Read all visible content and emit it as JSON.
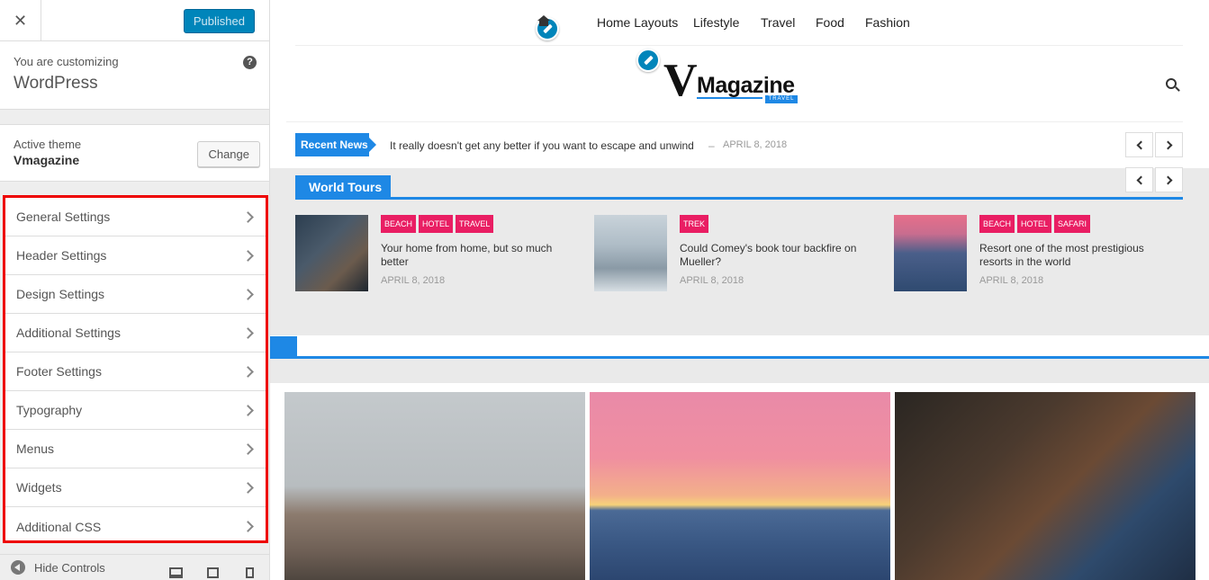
{
  "sidebar": {
    "close_symbol": "✕",
    "publish_label": "Published",
    "customizing_label": "You are customizing",
    "site_name": "WordPress",
    "help_symbol": "?",
    "active_theme_label": "Active theme",
    "theme_name": "Vmagazine",
    "change_label": "Change",
    "panels": [
      "General Settings",
      "Header Settings",
      "Design Settings",
      "Additional Settings",
      "Footer Settings",
      "Typography",
      "Menus",
      "Widgets",
      "Additional CSS"
    ],
    "hide_controls_label": "Hide Controls"
  },
  "preview": {
    "nav": [
      "Home Layouts",
      "Lifestyle",
      "Travel",
      "Food",
      "Fashion"
    ],
    "logo": {
      "initial": "V",
      "name": "Magazine",
      "tagline": "TRAVEL"
    },
    "ticker": {
      "label": "Recent News",
      "text": "It really doesn't get any better if you want to escape and unwind",
      "dash": "–",
      "date": "APRIL 8, 2018"
    },
    "world_tours": {
      "title": "World Tours",
      "posts": [
        {
          "tags": [
            "BEACH",
            "HOTEL",
            "TRAVEL"
          ],
          "title": "Your home from home, but so much better",
          "date": "APRIL 8, 2018"
        },
        {
          "tags": [
            "TREK"
          ],
          "title": "Could Comey's book tour backfire on Mueller?",
          "date": "APRIL 8, 2018"
        },
        {
          "tags": [
            "BEACH",
            "HOTEL",
            "SAFARI"
          ],
          "title": "Resort one of the most prestigious resorts in the world",
          "date": "APRIL 8, 2018"
        }
      ]
    }
  },
  "colors": {
    "accent": "#1e88e5",
    "tag": "#e91e63",
    "publish": "#0085ba",
    "highlight_border": "#ee0000"
  }
}
